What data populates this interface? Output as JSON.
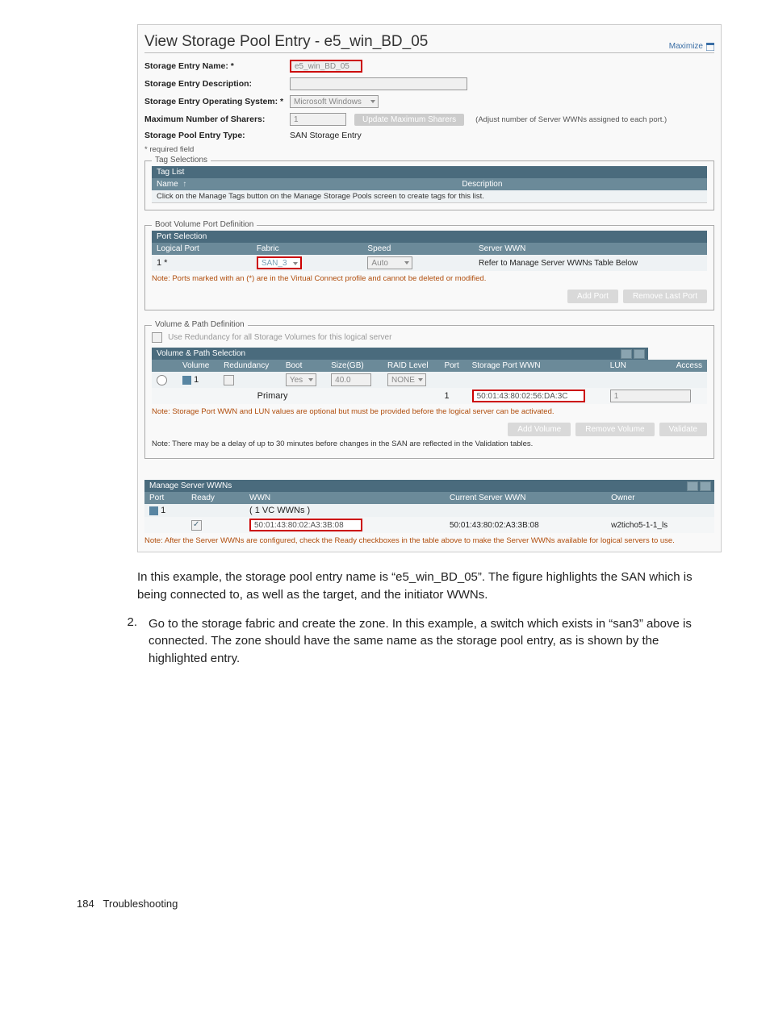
{
  "page_title": "View Storage Pool Entry - e5_win_BD_05",
  "maximize_label": "Maximize",
  "form": {
    "entry_name_label": "Storage Entry Name: *",
    "entry_name_value": "e5_win_BD_05",
    "entry_desc_label": "Storage Entry Description:",
    "entry_desc_value": "",
    "os_label": "Storage Entry Operating System: *",
    "os_value": "Microsoft Windows",
    "sharers_label": "Maximum Number of Sharers:",
    "sharers_value": "1",
    "sharers_button": "Update Maximum Sharers",
    "sharers_hint": "(Adjust number of Server WWNs assigned to each port.)",
    "type_label": "Storage Pool Entry Type:",
    "type_value": "SAN Storage Entry",
    "required_note": "* required field"
  },
  "tags": {
    "legend": "Tag Selections",
    "header_list": "Tag List",
    "col_name": "Name",
    "col_desc": "Description",
    "empty_text": "Click on the Manage Tags button on the Manage Storage Pools screen to create tags for this list."
  },
  "boot": {
    "legend": "Boot Volume Port Definition",
    "header": "Port Selection",
    "col_logical": "Logical Port",
    "col_fabric": "Fabric",
    "col_speed": "Speed",
    "col_server": "Server WWN",
    "row_port": "1 *",
    "row_fabric": "SAN_3",
    "row_speed": "Auto",
    "row_wwn": "Refer to Manage Server WWNs Table Below",
    "note": "Note: Ports marked with an (*) are in the Virtual Connect profile and cannot be deleted or modified.",
    "btn_add": "Add Port",
    "btn_remove": "Remove Last Port"
  },
  "vol": {
    "legend": "Volume & Path Definition",
    "redundancy_label": "Use Redundancy for all Storage Volumes for this logical server",
    "header": "Volume & Path Selection",
    "col_volume": "Volume",
    "col_redundancy": "Redundancy",
    "col_boot": "Boot",
    "col_size": "Size(GB)",
    "col_raid": "RAID Level",
    "col_port": "Port",
    "col_spwwn": "Storage Port WWN",
    "col_lun": "LUN",
    "col_access": "Access",
    "row_vol": "1",
    "row_boot": "Yes",
    "row_size": "40.0",
    "row_raid": "NONE",
    "row_path_label": "Primary",
    "row_path_port": "1",
    "row_path_wwn": "50:01:43:80:02:56:DA:3C",
    "row_path_lun": "1",
    "note1": "Note: Storage Port WWN and LUN values are optional but must be provided before the logical server can be activated.",
    "btn_add": "Add Volume",
    "btn_remove": "Remove Volume",
    "btn_validate": "Validate",
    "note2": "Note: There may be a delay of up to 30 minutes before changes in the SAN are reflected in the Validation tables."
  },
  "mswwn": {
    "header": "Manage Server WWNs",
    "col_port": "Port",
    "col_ready": "Ready",
    "col_wwn": "WWN",
    "col_current": "Current Server WWN",
    "col_owner": "Owner",
    "row_port": "1",
    "row_vc": "( 1 VC WWNs )",
    "row_wwn": "50:01:43:80:02:A3:3B:08",
    "row_current": "50:01:43:80:02:A3:3B:08",
    "row_owner": "w2ticho5-1-1_ls",
    "note": "Note: After the Server WWNs are configured, check the Ready checkboxes in the table above to make the Server WWNs available for logical servers to use."
  },
  "body_text": {
    "p1": "In this example, the storage pool entry name is “e5_win_BD_05”. The figure highlights the SAN which is being connected to, as well as the target, and the initiator WWNs.",
    "step_num": "2.",
    "step_text": "Go to the storage fabric and create the zone. In this example, a switch which exists in “san3” above is connected. The zone should have the same name as the storage pool entry, as is shown by the highlighted entry."
  },
  "footer": {
    "page": "184",
    "section": "Troubleshooting"
  }
}
